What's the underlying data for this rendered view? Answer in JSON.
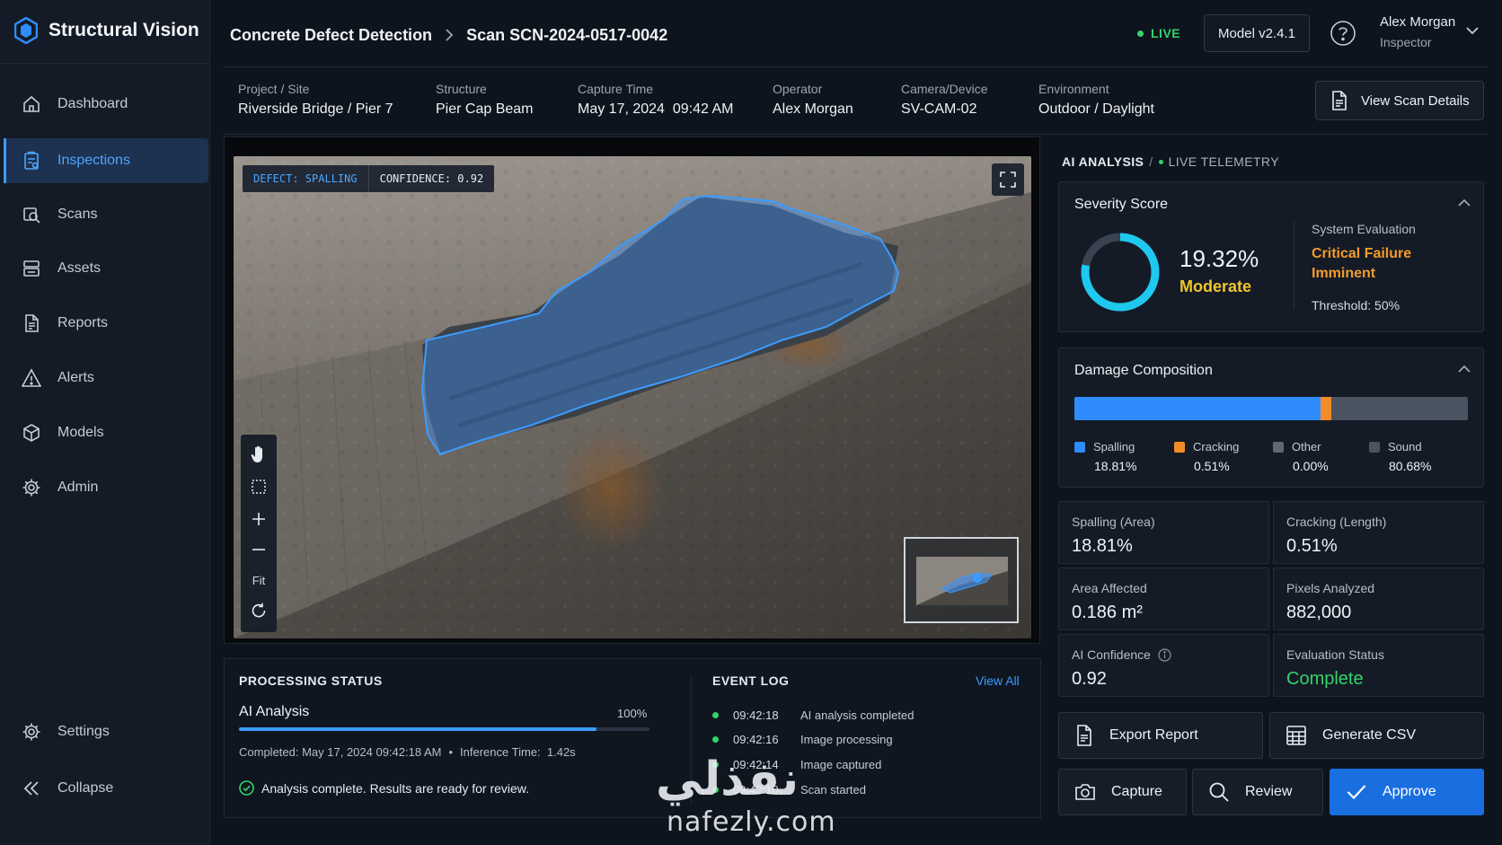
{
  "brand": {
    "name": "Structural Vision",
    "accent": "#2f8cff"
  },
  "sidebar": {
    "items": [
      {
        "label": "Dashboard",
        "icon": "home-icon"
      },
      {
        "label": "Inspections",
        "icon": "clipboard-icon",
        "active": true
      },
      {
        "label": "Scans",
        "icon": "scan-icon"
      },
      {
        "label": "Assets",
        "icon": "database-icon"
      },
      {
        "label": "Reports",
        "icon": "report-icon"
      },
      {
        "label": "Alerts",
        "icon": "warning-icon"
      },
      {
        "label": "Models",
        "icon": "cube-icon"
      },
      {
        "label": "Admin",
        "icon": "gear-icon"
      }
    ],
    "settings_label": "Settings",
    "collapse_label": "Collapse"
  },
  "header": {
    "crumb_root": "Concrete Defect Detection",
    "crumb_current": "Scan SCN-2024-0517-0042",
    "live_label": "LIVE",
    "live_color": "#34d36b",
    "model_label": "Model v2.4.1",
    "user_name": "Alex Morgan",
    "user_role": "Inspector"
  },
  "meta": {
    "items": [
      {
        "label": "Project / Site",
        "value": "Riverside Bridge / Pier 7"
      },
      {
        "label": "Structure",
        "value": "Pier Cap Beam"
      },
      {
        "label": "Capture Time",
        "value": "May 17, 2024  09:42 AM"
      },
      {
        "label": "Operator",
        "value": "Alex Morgan"
      },
      {
        "label": "Camera/Device",
        "value": "SV-CAM-02"
      },
      {
        "label": "Environment",
        "value": "Outdoor / Daylight"
      }
    ],
    "view_details_label": "View Scan Details"
  },
  "viewer": {
    "defect_label": "DEFECT: SPALLING",
    "confidence_label": "CONFIDENCE: 0.92",
    "fit_label": "Fit",
    "tools": [
      "hand-icon",
      "select-box-icon",
      "zoom-in-icon",
      "zoom-out-icon",
      "fit",
      "reset-icon"
    ]
  },
  "processing": {
    "title": "PROCESSING STATUS",
    "task": "AI Analysis",
    "percent_label": "100%",
    "progress_fill": 0.87,
    "completed": "Completed: May 17, 2024 09:42:18 AM",
    "inference": "Inference Time:  1.42s",
    "message": "Analysis complete. Results are ready for review."
  },
  "event_log": {
    "title": "EVENT LOG",
    "view_all": "View All",
    "events": [
      {
        "time": "09:42:18",
        "text": "AI analysis completed"
      },
      {
        "time": "09:42:16",
        "text": "Image processing"
      },
      {
        "time": "09:42:14",
        "text": "Image captured"
      },
      {
        "time": "09:42:10",
        "text": "Scan started"
      }
    ]
  },
  "ai": {
    "title": "AI ANALYSIS",
    "telemetry": "LIVE TELEMETRY",
    "severity": {
      "title": "Severity Score",
      "score_label": "19.32%",
      "score_value": 0.1932,
      "level": "Moderate",
      "system_eval_label": "System Evaluation",
      "system_eval_value": "Critical Failure Imminent",
      "threshold": "Threshold: 50%",
      "level_color": "#f0c52b",
      "eval_color": "#f29b2a",
      "ring_color": "#1fc8ee"
    },
    "damage": {
      "title": "Damage Composition",
      "segments": [
        {
          "name": "Spalling",
          "value": "18.81%",
          "share": 0.6249,
          "color": "#2f8cff"
        },
        {
          "name": "Cracking",
          "value": "0.51%",
          "share": 0.0272,
          "color": "#f28c28"
        },
        {
          "name": "Other",
          "value": "0.00%",
          "share": 0.0,
          "color": "#5e6773"
        },
        {
          "name": "Sound",
          "value": "80.68%",
          "share": 0.3479,
          "color": "#4a5360"
        }
      ]
    },
    "stats": [
      {
        "label": "Spalling (Area)",
        "value": "18.81%"
      },
      {
        "label": "Cracking (Length)",
        "value": "0.51%"
      },
      {
        "label": "Area Affected",
        "value": "0.186 m²"
      },
      {
        "label": "Pixels Analyzed",
        "value": "882,000"
      },
      {
        "label": "AI Confidence",
        "value": "0.92",
        "info": true
      },
      {
        "label": "Evaluation Status",
        "value": "Complete",
        "color": "#34d36b"
      }
    ],
    "actions": {
      "export": "Export Report",
      "csv": "Generate CSV",
      "capture": "Capture",
      "review": "Review",
      "approve": "Approve"
    }
  },
  "watermark": {
    "arabic": "نفذلي",
    "latin": "nafezly.com"
  }
}
